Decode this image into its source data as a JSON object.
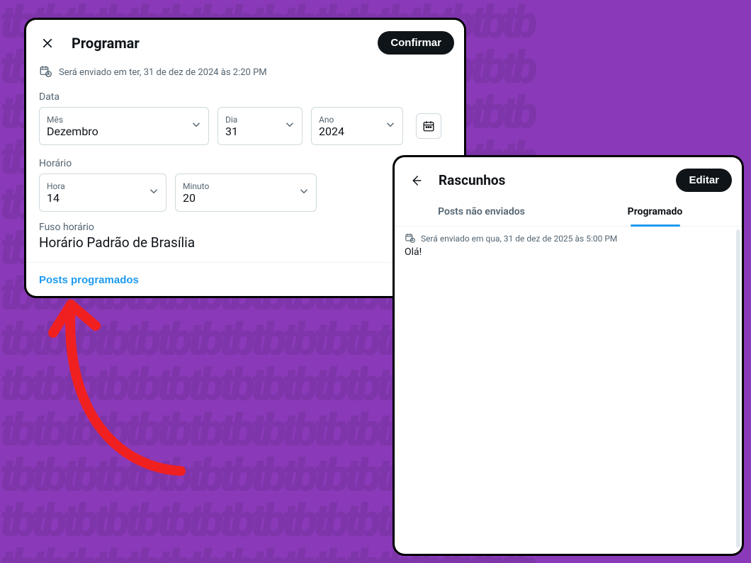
{
  "schedule_modal": {
    "title": "Programar",
    "confirm_label": "Confirmar",
    "will_send_text": "Será enviado em ter, 31 de dez de 2024 às 2:20 PM",
    "date_section_label": "Data",
    "month": {
      "label": "Mês",
      "value": "Dezembro"
    },
    "day": {
      "label": "Dia",
      "value": "31"
    },
    "year": {
      "label": "Ano",
      "value": "2024"
    },
    "time_section_label": "Horário",
    "hour": {
      "label": "Hora",
      "value": "14"
    },
    "minute": {
      "label": "Minuto",
      "value": "20"
    },
    "timezone_label": "Fuso horário",
    "timezone_value": "Horário Padrão de Brasília",
    "scheduled_posts_link": "Posts programados"
  },
  "drafts_modal": {
    "title": "Rascunhos",
    "edit_label": "Editar",
    "tab_unsent": "Posts não enviados",
    "tab_scheduled": "Programado",
    "item": {
      "info": "Será enviado em qua, 31 de dez de 2025 às 5:00 PM",
      "text": "Olá!"
    }
  }
}
